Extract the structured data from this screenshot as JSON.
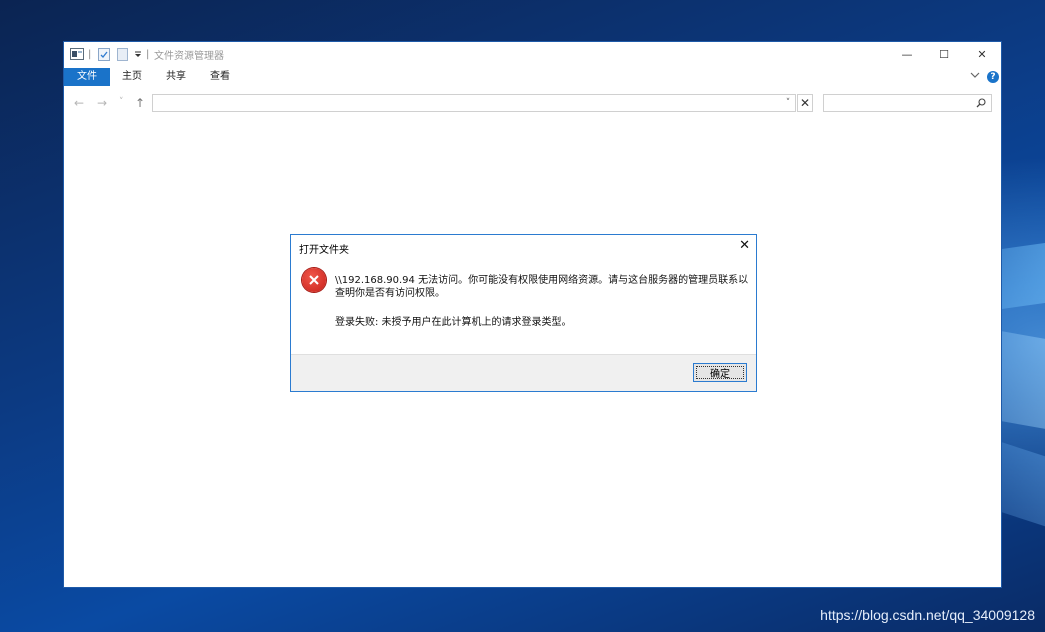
{
  "window": {
    "title": "文件资源管理器",
    "quick_access_separator": "|",
    "controls": {
      "minimize": "—",
      "maximize": "☐",
      "close": "✕"
    }
  },
  "ribbon": {
    "tabs": [
      "文件",
      "主页",
      "共享",
      "查看"
    ],
    "expand_icon": "chevron-down-icon",
    "help_label": "?"
  },
  "navigation": {
    "back_icon": "←",
    "forward_icon": "→",
    "recent_icon": "˅",
    "up_icon": "↑",
    "address_value": "",
    "address_dropdown": "˅",
    "address_clear": "✕",
    "search_value": "",
    "search_icon": "⌕"
  },
  "dialog": {
    "title": "打开文件夹",
    "close_label": "✕",
    "message_line1": "\\\\192.168.90.94 无法访问。你可能没有权限使用网络资源。请与这台服务器的管理员联系以",
    "message_line2": "查明你是否有访问权限。",
    "detail": "登录失败: 未授予用户在此计算机上的请求登录类型。",
    "ok_label": "确定"
  },
  "colors": {
    "accent": "#1a73c9",
    "error": "#d9261c",
    "help_badge": "#1a73c9"
  },
  "watermark": "https://blog.csdn.net/qq_34009128"
}
